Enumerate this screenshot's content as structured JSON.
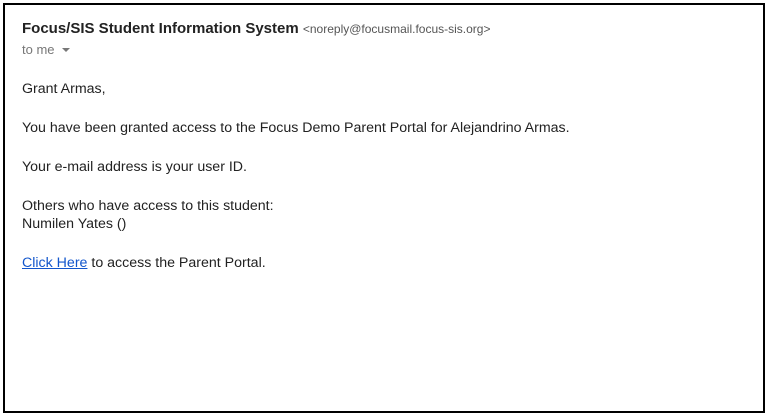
{
  "email": {
    "sender_name": "Focus/SIS Student Information System",
    "sender_address": "<noreply@focusmail.focus-sis.org>",
    "recipient_label": "to me",
    "recipient_icon": "chevron-down-icon",
    "body": {
      "greeting": "Grant Armas,",
      "access_message": "You have been granted access to the Focus Demo Parent Portal for Alejandrino Armas.",
      "user_id_message": "Your e-mail address is your user ID.",
      "others_label": "Others who have access to this student:",
      "others_name": "Numilen Yates ()",
      "link_text": "Click Here",
      "link_suffix": " to access the Parent Portal."
    }
  },
  "colors": {
    "link": "#1155cc",
    "text": "#222222",
    "muted": "#777777",
    "border": "#000000"
  }
}
